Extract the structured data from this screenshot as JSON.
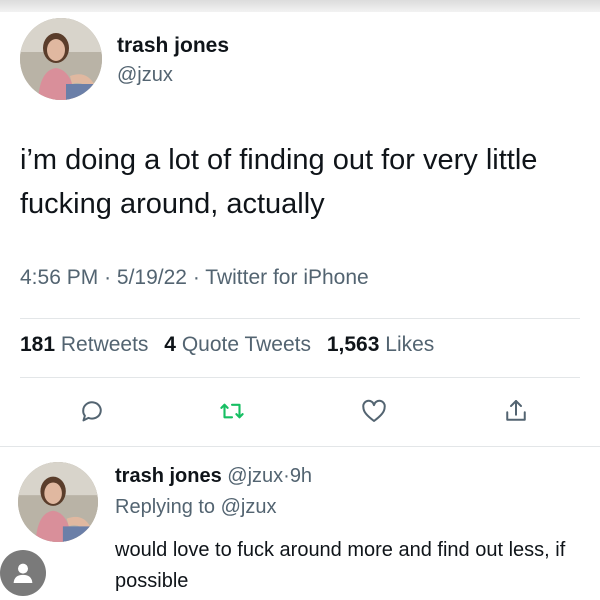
{
  "tweet": {
    "display_name": "trash jones",
    "handle": "@jzux",
    "text": "i’m doing a lot of finding out for very little fucking around, actually",
    "time": "4:56 PM",
    "date": "5/19/22",
    "separator": "·",
    "source": "Twitter for iPhone"
  },
  "stats": {
    "retweets_count": "181",
    "retweets_label": "Retweets",
    "quotes_count": "4",
    "quotes_label": "Quote Tweets",
    "likes_count": "1,563",
    "likes_label": "Likes"
  },
  "actions": {
    "reply_icon": "speech-bubble-icon",
    "retweet_icon": "retweet-arrows-icon",
    "like_icon": "heart-icon",
    "share_icon": "share-upload-icon",
    "accent_color": "#1d9bf0"
  },
  "reply": {
    "display_name": "trash jones",
    "handle": "@jzux",
    "age": "9h",
    "separator": "·",
    "replying_label": "Replying to",
    "replying_to": "@jzux",
    "text": "would love to fuck around more and find out less, if possible"
  },
  "colors": {
    "text_primary": "#0f1419",
    "text_secondary": "#536471",
    "divider": "#e3e6e8"
  }
}
